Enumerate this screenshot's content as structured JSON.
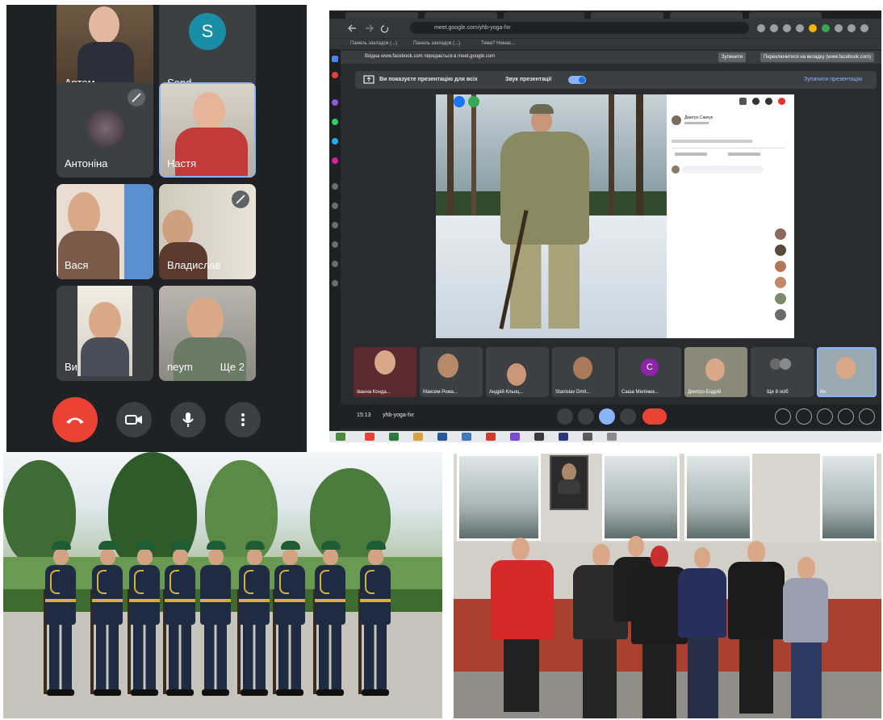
{
  "phone_meet": {
    "tiles": [
      {
        "name": "Артем"
      },
      {
        "name": "Send",
        "avatar_letter": "S"
      },
      {
        "name": "Антоніна"
      },
      {
        "name": "Настя"
      },
      {
        "name": "Вася"
      },
      {
        "name": "Владислав"
      },
      {
        "name": "Ви"
      },
      {
        "name": "neym",
        "more": "Ще 2"
      }
    ]
  },
  "desktop_meet": {
    "address": "meet.google.com/yhb-yoga-fxr",
    "bookmarks": [
      "Панель закладок (...)",
      "Панель закладок (...)",
      "Тема? Немає..."
    ],
    "info_bar": {
      "text": "Вхідна www.facebook.com передається в meet.google.com",
      "stop": "Зупинити",
      "switch": "Переключитися на вкладку (www.facebook.com)"
    },
    "presentation_bar": {
      "message": "Ви показуєте презентацію для всіх",
      "sound": "Звук презентації",
      "stop": "Зупинити презентацію"
    },
    "fb_panel": {
      "author": "Дмитро Савчук"
    },
    "thumbnails": [
      {
        "name": "Іванна Конда..."
      },
      {
        "name": "Максим Рома..."
      },
      {
        "name": "Андрій Кльоц..."
      },
      {
        "name": "Stanislav Dmit..."
      },
      {
        "name": "Саша Мелінюк...",
        "avatar_letter": "С"
      },
      {
        "name": "Дмитро Бодрій"
      },
      {
        "name": "Ще 8 осіб"
      },
      {
        "name": "Ви"
      }
    ],
    "bottom_bar": {
      "time": "15:13",
      "meeting_code": "yhb-yoga-fxr"
    },
    "colors": {
      "end_call": "#ea4335",
      "accent": "#8ab4f8"
    }
  }
}
